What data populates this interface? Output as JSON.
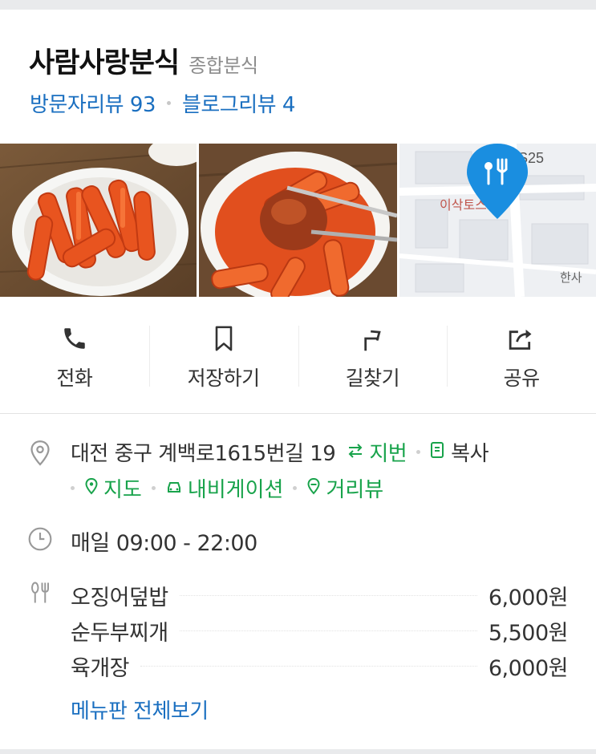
{
  "place": {
    "name": "사람사랑분식",
    "category": "종합분식"
  },
  "reviews": {
    "visitor": "방문자리뷰 93",
    "blog": "블로그리뷰 4"
  },
  "photos": [
    {
      "name": "tteokbokki-photo-1"
    },
    {
      "name": "tteokbokki-photo-2"
    },
    {
      "name": "map-thumbnail"
    }
  ],
  "map_thumb": {
    "labels": [
      "S25",
      "이삭토스트",
      "한사"
    ],
    "pin_color": "#1a8ee0"
  },
  "actions": [
    {
      "label": "전화",
      "icon": "phone-icon"
    },
    {
      "label": "저장하기",
      "icon": "bookmark-icon"
    },
    {
      "label": "길찾기",
      "icon": "directions-icon"
    },
    {
      "label": "공유",
      "icon": "share-icon"
    }
  ],
  "address": {
    "text": "대전 중구 계백로1615번길 19",
    "jibun": "지번",
    "copy": "복사",
    "map": "지도",
    "navigation": "내비게이션",
    "streetview": "거리뷰"
  },
  "hours": {
    "text": "매일 09:00 - 22:00"
  },
  "menu": {
    "items": [
      {
        "name": "오징어덮밥",
        "price": "6,000원"
      },
      {
        "name": "순두부찌개",
        "price": "5,500원"
      },
      {
        "name": "육개장",
        "price": "6,000원"
      }
    ],
    "view_all": "메뉴판 전체보기"
  },
  "colors": {
    "link_blue": "#1a6fc0",
    "green": "#18a34b",
    "pin_blue": "#1a8ee0"
  }
}
